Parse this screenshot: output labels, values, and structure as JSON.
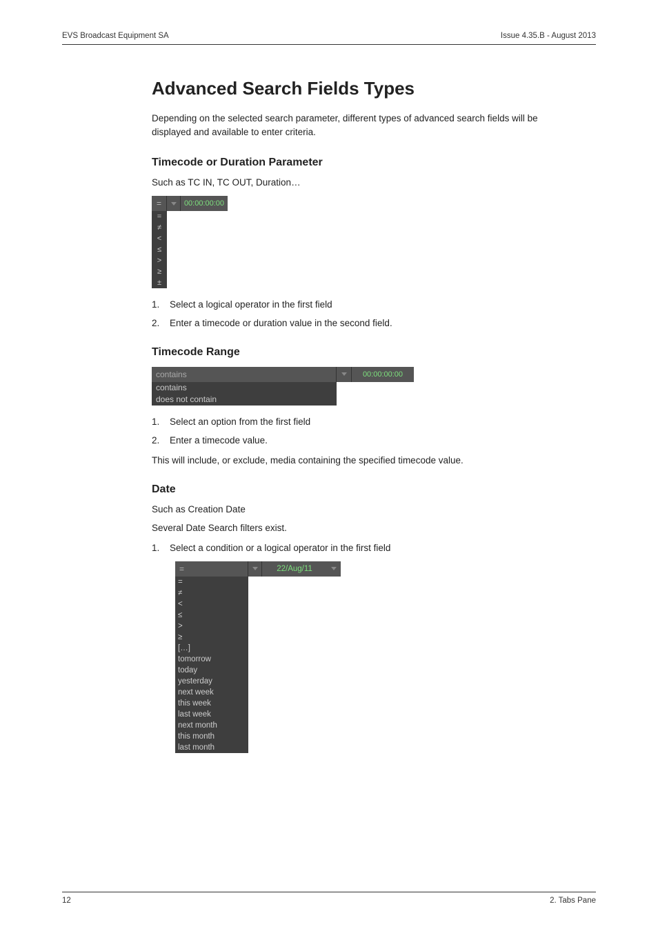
{
  "header": {
    "left": "EVS Broadcast Equipment SA",
    "right": "Issue 4.35.B - August 2013"
  },
  "title": "Advanced Search Fields Types",
  "intro": "Depending on the selected search parameter, different types of advanced search fields will be displayed and available to enter criteria.",
  "sec1": {
    "heading": "Timecode or Duration Parameter",
    "sub": "Such as TC IN, TC OUT, Duration…",
    "fig": {
      "selected": "=",
      "tc": "00:00:00:00",
      "options": [
        "=",
        "≠",
        "<",
        "≤",
        ">",
        "≥",
        "±"
      ]
    },
    "steps": [
      "Select a logical operator in the first field",
      "Enter a timecode or duration value in the second field."
    ]
  },
  "sec2": {
    "heading": "Timecode Range",
    "fig": {
      "selected": "contains",
      "tc": "00:00:00:00",
      "options": [
        "contains",
        "does not contain"
      ]
    },
    "steps": [
      "Select an option from the first field",
      "Enter a timecode value."
    ],
    "note": "This will include, or exclude, media containing the specified timecode value."
  },
  "sec3": {
    "heading": "Date",
    "sub1": "Such as Creation Date",
    "sub2": "Several Date Search filters exist.",
    "step1": "Select a condition or a logical operator in the first field",
    "fig": {
      "selected": "=",
      "date": "22/Aug/11",
      "options": [
        "=",
        "≠",
        "<",
        "≤",
        ">",
        "≥",
        "[…]",
        "tomorrow",
        "today",
        "yesterday",
        "next week",
        "this week",
        "last week",
        "next month",
        "this month",
        "last month"
      ]
    }
  },
  "footer": {
    "left": "12",
    "right": "2. Tabs Pane"
  }
}
